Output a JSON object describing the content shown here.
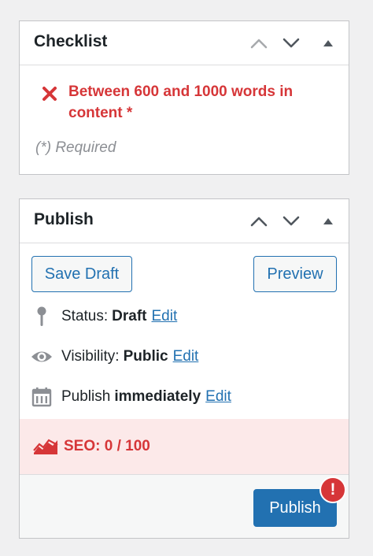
{
  "checklist": {
    "title": "Checklist",
    "items": [
      {
        "text": "Between 600 and 1000 words in content *",
        "status": "failed",
        "icon": "x-icon"
      }
    ],
    "required_note": "(*) Required"
  },
  "publish": {
    "title": "Publish",
    "save_draft_label": "Save Draft",
    "preview_label": "Preview",
    "status": {
      "label": "Status:",
      "value": "Draft",
      "edit": "Edit",
      "icon": "pin-icon"
    },
    "visibility": {
      "label": "Visibility:",
      "value": "Public",
      "edit": "Edit",
      "icon": "eye-icon"
    },
    "schedule": {
      "label": "Publish",
      "value": "immediately",
      "edit": "Edit",
      "icon": "calendar-icon"
    },
    "seo": {
      "text": "SEO: 0 / 100",
      "score": 0,
      "max": 100,
      "icon": "seo-score-icon"
    },
    "publish_label": "Publish",
    "alert_badge": "!"
  },
  "colors": {
    "accent": "#2271b1",
    "error": "#d63638",
    "error_bg": "#fce9e9",
    "muted": "#8c8f94",
    "border": "#c3c4c7",
    "page_bg": "#f0f0f1"
  }
}
